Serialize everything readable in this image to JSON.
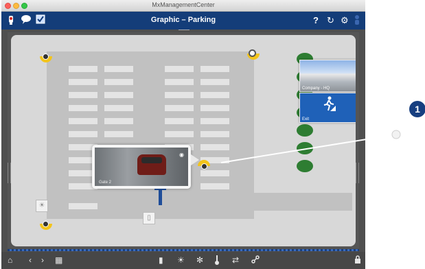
{
  "window": {
    "title": "MxManagementCenter"
  },
  "appbar": {
    "title": "Graphic – Parking",
    "left_icons": [
      "camera-icon",
      "chat-icon",
      "checklist-icon"
    ],
    "right_icons": [
      "help-icon",
      "reload-icon",
      "settings-icon",
      "user-icon"
    ],
    "help_glyph": "?",
    "reload_glyph": "↻",
    "settings_glyph": "⚙"
  },
  "map": {
    "popup": {
      "camera_label": "Gate 2"
    },
    "thumbnails": [
      {
        "label": "Company - HQ"
      },
      {
        "label": "Exit"
      }
    ]
  },
  "toolbar": {
    "left_icons": [
      "home-icon",
      "back-icon",
      "forward-icon",
      "grid-icon"
    ],
    "center_icons": [
      "door-icon",
      "light-icon",
      "dim-icon",
      "temperature-icon",
      "swap-icon",
      "link-icon"
    ],
    "right_icons": [
      "lock-icon"
    ],
    "glyphs": {
      "home": "⌂",
      "back": "‹",
      "forward": "›",
      "grid": "▦",
      "door": "▮",
      "light": "☀",
      "dim": "✻",
      "temp": "🌡",
      "swap": "⇄",
      "link": "🔗",
      "lock": "🔒"
    }
  },
  "annotation": {
    "callout_number": "1"
  },
  "colors": {
    "appbar": "#143d79",
    "accent_yellow": "#f3c41a",
    "slot_green": "#2e7d32"
  }
}
